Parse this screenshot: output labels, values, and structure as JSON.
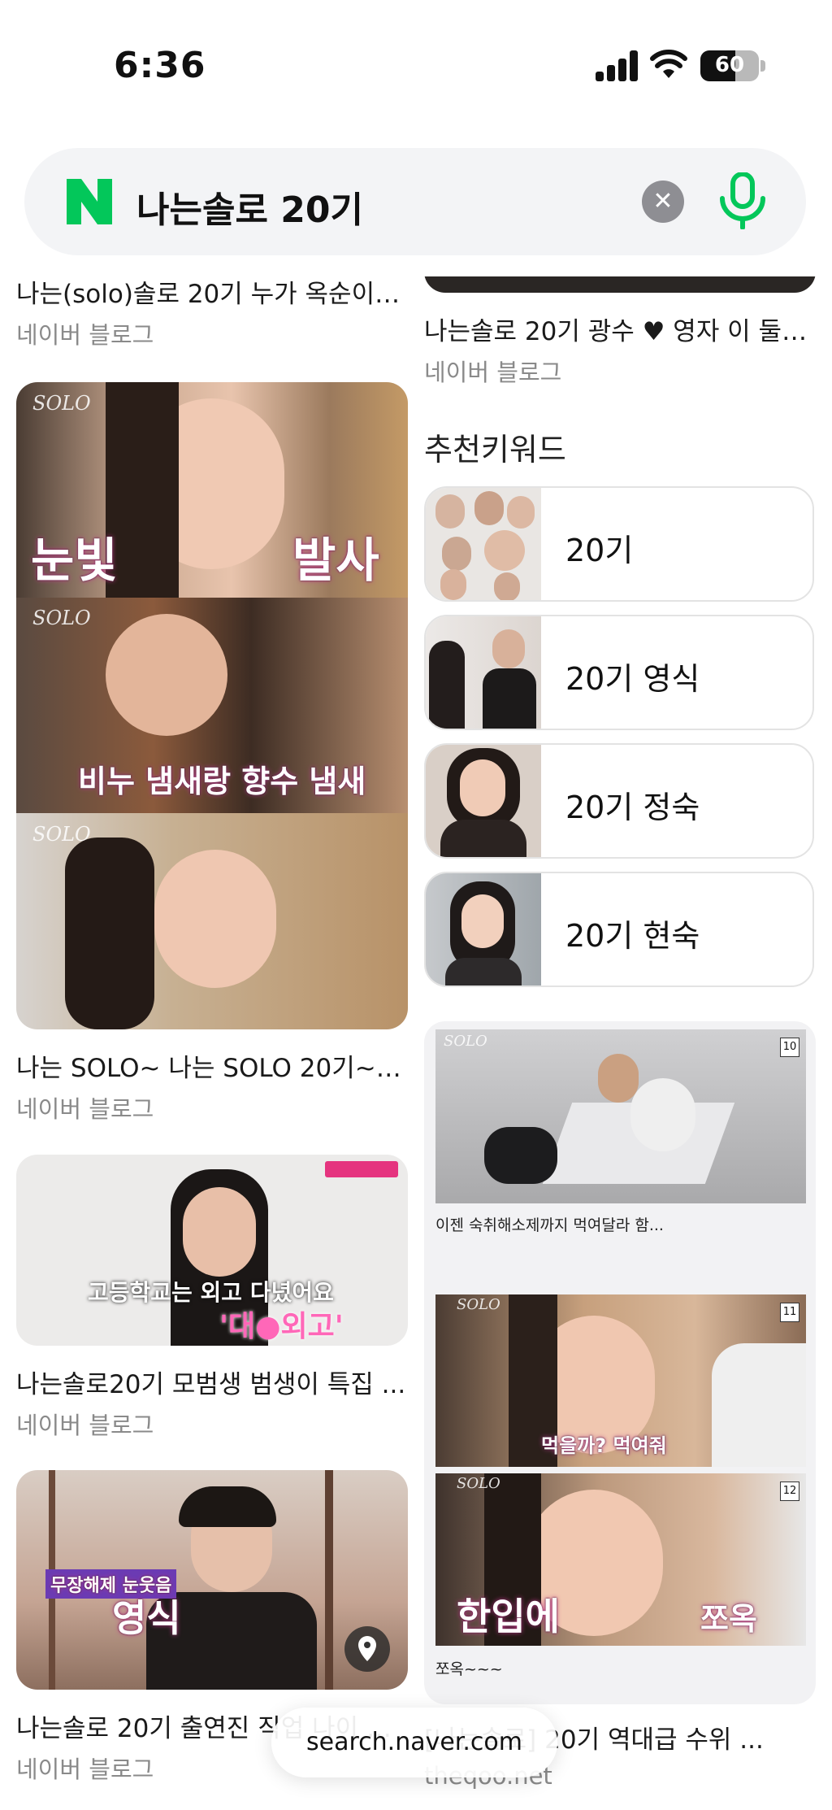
{
  "status_bar": {
    "time": "6:36",
    "battery": "60"
  },
  "search": {
    "query": "나는솔로 20기",
    "clear_label": "✕"
  },
  "left_column": [
    {
      "title": "나는(solo)솔로 20기 누가 옥순이야...",
      "source": "네이버 블로그"
    },
    {
      "title": "나는 SOLO~ 나는 SOLO 20기~영...",
      "source": "네이버 블로그",
      "captions": [
        "눈빛",
        "발사",
        "비누 냄새랑 향수 냄새"
      ]
    },
    {
      "title": "나는솔로20기 모범생 범생이 특집 ...",
      "source": "네이버 블로그",
      "captions": [
        "고등학교는 외고 다녔어요",
        "'대●외고'"
      ]
    },
    {
      "title": "나는솔로 20기 출연진 직업 나이 인...",
      "source": "네이버 블로그",
      "captions": [
        "무장해제 눈웃음",
        "영식"
      ]
    }
  ],
  "right_column": {
    "top_item": {
      "title": "나는솔로 20기 광수 ♥ 영자 이 둘이...",
      "source": "네이버 블로그"
    },
    "recommend_title": "추천키워드",
    "keywords": [
      "20기",
      "20기 영식",
      "20기 정숙",
      "20기 현숙"
    ],
    "collage": {
      "episodes": [
        "10",
        "11",
        "12"
      ],
      "caption1": "이젠 숙취해소제까지 먹여달라 함...",
      "caption2": "먹을까? 먹여줘",
      "caption3_left": "한입에",
      "caption3_right": "쪼옥",
      "caption4": "쪼옥~~~"
    },
    "bottom_item": {
      "title": "[나는솔로] 20기 역대급 수위 ...",
      "source": "theqoo.net"
    }
  },
  "url_bar": "search.naver.com",
  "brand_marks": {
    "solo": "SOLO"
  },
  "colors": {
    "naver_green": "#03c75a",
    "text": "#111111",
    "muted": "#8a8a8a"
  }
}
